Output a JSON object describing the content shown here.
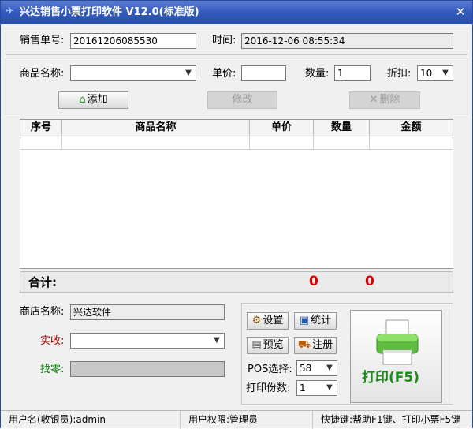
{
  "window": {
    "title": "兴达销售小票打印软件 V12.0(标准版)",
    "close_glyph": "✕"
  },
  "order": {
    "number_label": "销售单号:",
    "number_value": "20161206085530",
    "time_label": "时间:",
    "time_value": "2016-12-06 08:55:34"
  },
  "item": {
    "name_label": "商品名称:",
    "name_value": "",
    "price_label": "单价:",
    "price_value": "",
    "qty_label": "数量:",
    "qty_value": "1",
    "discount_label": "折扣:",
    "discount_value": "10"
  },
  "actions": {
    "add": "添加",
    "edit": "修改",
    "delete": "删除"
  },
  "table": {
    "columns": [
      "序号",
      "商品名称",
      "单价",
      "数量",
      "金额"
    ]
  },
  "total": {
    "label": "合计:",
    "qty": "0",
    "amount": "0"
  },
  "shop": {
    "name_label": "商店名称:",
    "name_value": "兴达软件",
    "received_label": "实收:",
    "received_value": "",
    "change_label": "找零:",
    "change_value": ""
  },
  "tools": {
    "settings": "设置",
    "stats": "统计",
    "preview": "预览",
    "register": "注册",
    "pos_label": "POS选择:",
    "pos_value": "58",
    "copies_label": "打印份数:",
    "copies_value": "1"
  },
  "print": {
    "label": "打印(F5)"
  },
  "status": {
    "user": "用户名(收银员):admin",
    "role": "用户权限:管理员",
    "hotkeys": "快捷键:帮助F1键、打印小票F5键"
  },
  "colors": {
    "title_bar": "#3259bd",
    "total_red": "#e00000",
    "received_label": "#a00000",
    "change_label": "#008000",
    "print_text": "#1e8a1e"
  }
}
